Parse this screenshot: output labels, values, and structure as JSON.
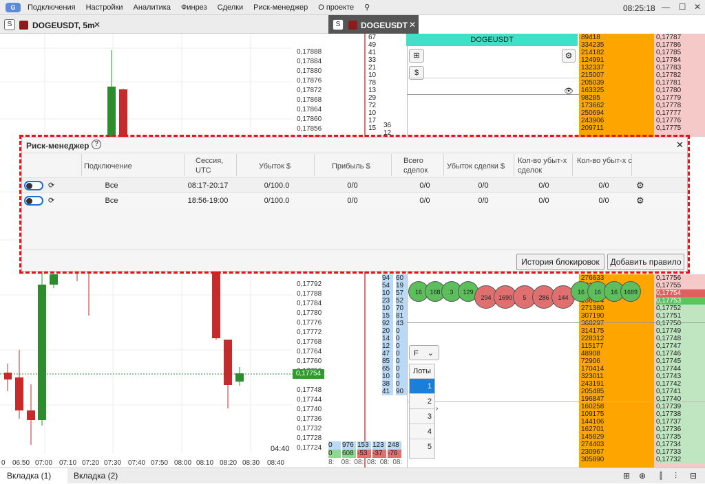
{
  "app": {
    "menu": [
      "Подключения",
      "Настройки",
      "Аналитика",
      "Финрез",
      "Сделки",
      "Риск-менеджер",
      "О проекте"
    ],
    "clock": "08:25:18"
  },
  "left_panel": {
    "tab_s": "S",
    "tab_title": "DOGEUSDT, 5m",
    "price_labels": [
      "0,17888",
      "0,17884",
      "0,17880",
      "0,17876",
      "0,17872",
      "0,17868",
      "0,17864",
      "0,17860",
      "0,17856",
      "0,17852",
      "0,17792",
      "0,17788",
      "0,17784",
      "0,17780",
      "0,17776",
      "0,17772",
      "0,17768",
      "0,17764",
      "0,17760",
      "0,17756",
      "0,17748",
      "0,17744",
      "0,17740",
      "0,17736",
      "0,17732",
      "0,17728",
      "0,17724"
    ],
    "current_price": "0,17754",
    "time_labels": [
      "0",
      "06:50",
      "07:00",
      "07:10",
      "07:20",
      "07:30",
      "07:40",
      "07:50",
      "08:00",
      "08:10",
      "08:20",
      "08:30",
      "08:40"
    ],
    "corner_time": "04:40"
  },
  "right_panel": {
    "tab_s": "S",
    "tab_title": "DOGEUSDT",
    "symbol_header": "DOGEUSDT",
    "lots_dropdown": "F",
    "lots_label": "Лоты",
    "lots": [
      "1",
      "2",
      "3",
      "4",
      "5"
    ],
    "top_counts": [
      "67",
      "49",
      "41",
      "33",
      "21",
      "10",
      "78",
      "13",
      "29",
      "72",
      "10",
      "17",
      "15"
    ],
    "top_counts2": [
      "36",
      "12"
    ],
    "top_volumes": [
      "89418",
      "334235",
      "214182",
      "124991",
      "132337",
      "215007",
      "205039",
      "163325",
      "98285",
      "173662",
      "250694",
      "243906",
      "209711"
    ],
    "top_prices": [
      "0,17787",
      "0,17786",
      "0,17785",
      "0,17784",
      "0,17783",
      "0,17782",
      "0,17781",
      "0,17780",
      "0,17779",
      "0,17778",
      "0,17777",
      "0,17776",
      "0,17775"
    ],
    "bottom_counts_a": [
      "94",
      "54",
      "10",
      "23",
      "10",
      "15",
      "92",
      "20",
      "14",
      "12",
      "47",
      "85",
      "65",
      "10",
      "38",
      "41"
    ],
    "bottom_counts_b": [
      "60",
      "19",
      "57",
      "52",
      "70",
      "81",
      "43",
      "0",
      "0",
      "0",
      "0",
      "0",
      "0",
      "0",
      "0",
      "90"
    ],
    "bottom_volumes": [
      "276633",
      "131834",
      "64331",
      "156674",
      "271380",
      "307190",
      "368297",
      "314175",
      "228312",
      "115177",
      "48908",
      "72906",
      "170414",
      "323011",
      "243191",
      "205485",
      "196847",
      "160258",
      "109175",
      "144106",
      "162701",
      "145829",
      "274403",
      "230967",
      "305890"
    ],
    "bottom_prices": [
      "0,17756",
      "0,17755",
      "0,17754",
      "0,17753",
      "0,17752",
      "0,17751",
      "0,17750",
      "0,17749",
      "0,17748",
      "0,17747",
      "0,17746",
      "0,17745",
      "0,17744",
      "0,17743",
      "0,17742",
      "0,17741",
      "0,17740",
      "0,17739",
      "0,17738",
      "0,17737",
      "0,17736",
      "0,17735",
      "0,17734",
      "0,17733",
      "0,17732"
    ],
    "bubbles_green": [
      "16",
      "168",
      "3",
      "129"
    ],
    "bubbles_red": [
      "294",
      "1690",
      "5",
      "286",
      "144"
    ],
    "bubbles_green2": [
      "16",
      "16",
      "16",
      "1689"
    ],
    "footer_row1": [
      "0",
      "976",
      "153",
      "123",
      "248"
    ],
    "footer_row2": [
      "0",
      "608",
      "-53",
      "-37",
      "-76"
    ],
    "footer_times": [
      "8:",
      "08:",
      "08:",
      "08:",
      "08:",
      "08:"
    ]
  },
  "bottom_tabs": [
    "Вкладка (1)",
    "Вкладка (2)"
  ],
  "risk_manager": {
    "title": "Риск-менеджер",
    "columns": [
      "Подключение",
      "Сессия, UTC",
      "Убыток $",
      "Прибыль $",
      "Всего сделок",
      "Убыток сделки $",
      "Кол-во убыт-х сделок",
      "Кол-во убыт-х сделок под..."
    ],
    "rows": [
      {
        "connection": "Все",
        "session": "08:17-20:17",
        "loss": "0/100.0",
        "profit": "0/0",
        "total_trades": "0/0",
        "trade_loss": "0/0",
        "loss_trades": "0/0",
        "loss_trades_row": "0/0"
      },
      {
        "connection": "Все",
        "session": "18:56-19:00",
        "loss": "0/100.0",
        "profit": "0/0",
        "total_trades": "0/0",
        "trade_loss": "0/0",
        "loss_trades": "0/0",
        "loss_trades_row": "0/0"
      }
    ],
    "history_button": "История блокировок",
    "add_button": "Добавить правило"
  },
  "colors": {
    "accent": "#1a6fd0",
    "highlight_dash": "#e8141b",
    "bid_orange": "#ffa500",
    "candle_up": "#2e8b2e",
    "candle_down": "#c62b2b"
  }
}
